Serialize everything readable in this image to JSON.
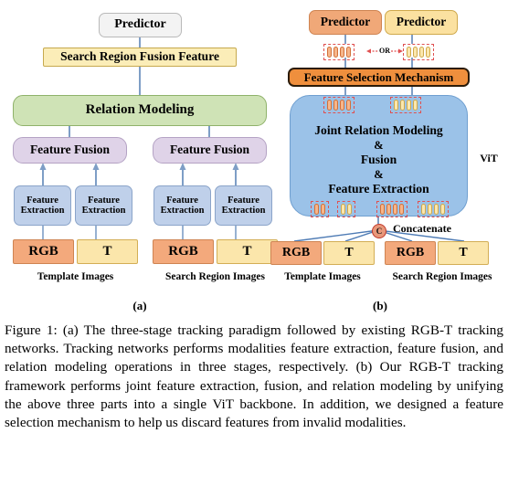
{
  "figure": {
    "panel_a": {
      "caption_label": "(a)",
      "predictor": "Predictor",
      "fusion_feature": "Search Region Fusion Feature",
      "relation_modeling": "Relation Modeling",
      "feature_fusion": [
        "Feature Fusion",
        "Feature Fusion"
      ],
      "feature_extraction": [
        "Feature\nExtraction",
        "Feature\nExtraction",
        "Feature\nExtraction",
        "Feature\nExtraction"
      ],
      "modalities": [
        "RGB",
        "T",
        "RGB",
        "T"
      ],
      "group_labels": [
        "Template Images",
        "Search Region Images"
      ]
    },
    "panel_b": {
      "caption_label": "(b)",
      "predictors": [
        "Predictor",
        "Predictor"
      ],
      "or_label": "OR",
      "feature_selection": "Feature Selection Mechanism",
      "vit_lines": [
        "Joint Relation Modeling",
        "&",
        "Fusion",
        "&",
        "Feature Extraction"
      ],
      "vit_label": "ViT",
      "concatenate_label": "Concatenate",
      "concat_node": "C",
      "modalities": [
        "RGB",
        "T",
        "RGB",
        "T"
      ],
      "group_labels": [
        "Template Images",
        "Search Region Images"
      ]
    },
    "caption": "Figure 1: (a) The three-stage tracking paradigm followed by existing RGB-T tracking networks. Tracking networks performs modalities feature extraction, feature fusion, and relation modeling operations in three stages, respectively. (b) Our RGB-T tracking framework performs joint feature extraction, fusion, and relation modeling by unifying the above three parts into a single ViT backbone. In addition, we designed a feature selection mechanism to help us discard features from invalid modalities."
  },
  "colors": {
    "rgb_orange": "#f0a878",
    "thermal_yellow": "#fbe1a0",
    "vit_blue": "#9bc2e8",
    "relation_green": "#cfe3b6",
    "fusion_purple": "#dfd3e8",
    "extraction_blue": "#bfd0ea",
    "selection_orange": "#ef8f3d",
    "connector_blue": "#7e9ec6",
    "dashed_red": "#e05050"
  }
}
